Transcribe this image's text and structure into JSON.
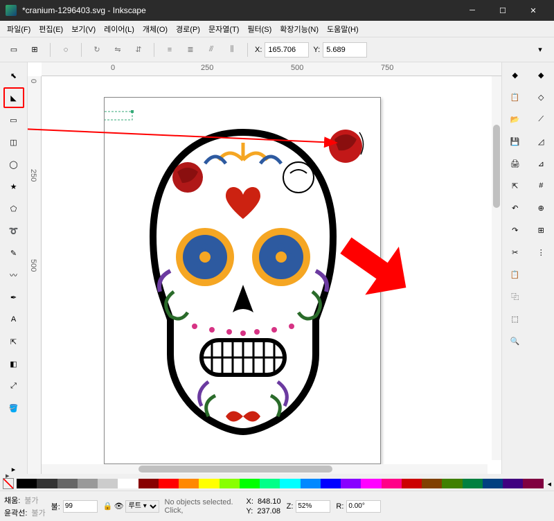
{
  "title": "*cranium-1296403.svg - Inkscape",
  "menus": [
    "파일(F)",
    "편집(E)",
    "보기(V)",
    "레이어(L)",
    "개체(O)",
    "경로(P)",
    "문자열(T)",
    "필터(S)",
    "확장기능(N)",
    "도움말(H)"
  ],
  "coords": {
    "xlabel": "X:",
    "xval": "165.706",
    "ylabel": "Y:",
    "yval": "5.689"
  },
  "ruler_h": [
    "0",
    "250",
    "500",
    "750"
  ],
  "ruler_v": [
    "0",
    "250",
    "500"
  ],
  "tools": [
    {
      "name": "select-tool",
      "glyph": "⬉"
    },
    {
      "name": "node-tool",
      "glyph": "◣",
      "hl": true
    },
    {
      "name": "rect-tool",
      "glyph": "▭"
    },
    {
      "name": "3dbox-tool",
      "glyph": "◫"
    },
    {
      "name": "ellipse-tool",
      "glyph": "◯"
    },
    {
      "name": "star-tool",
      "glyph": "★"
    },
    {
      "name": "poly-tool",
      "glyph": "⬠"
    },
    {
      "name": "spiral-tool",
      "glyph": "➰"
    },
    {
      "name": "pencil-tool",
      "glyph": "✎"
    },
    {
      "name": "bezier-tool",
      "glyph": "〰"
    },
    {
      "name": "calligraphy-tool",
      "glyph": "✒"
    },
    {
      "name": "text-tool",
      "glyph": "A"
    },
    {
      "name": "connector-tool",
      "glyph": "⇱"
    },
    {
      "name": "gradient-tool",
      "glyph": "◧"
    },
    {
      "name": "dropper-tool",
      "glyph": "⤢"
    },
    {
      "name": "paintbucket-tool",
      "glyph": "🪣"
    }
  ],
  "right_col1": [
    {
      "n": "fill-stroke-icon",
      "g": "◆"
    },
    {
      "n": "paste-icon",
      "g": "📋"
    },
    {
      "n": "open-icon",
      "g": "📂"
    },
    {
      "n": "save-icon",
      "g": "💾"
    },
    {
      "n": "print-icon",
      "g": "🖨"
    },
    {
      "n": "export-icon",
      "g": "⇱"
    },
    {
      "n": "undo-icon",
      "g": "↶"
    },
    {
      "n": "redo-icon",
      "g": "↷"
    },
    {
      "n": "cut-icon",
      "g": "✂"
    },
    {
      "n": "clipboard-icon",
      "g": "📋"
    },
    {
      "n": "duplicate-icon",
      "g": "⿻"
    },
    {
      "n": "group-icon",
      "g": "⬚"
    },
    {
      "n": "zoom-icon",
      "g": "🔍"
    }
  ],
  "right_col2": [
    {
      "n": "snap-icon",
      "g": "◆"
    },
    {
      "n": "snap-node-icon",
      "g": "◇"
    },
    {
      "n": "snap-path-icon",
      "g": "⟋"
    },
    {
      "n": "snap-corner-icon",
      "g": "◿"
    },
    {
      "n": "snap-edge-icon",
      "g": "⊿"
    },
    {
      "n": "snap-hash-icon",
      "g": "#"
    },
    {
      "n": "snap-center-icon",
      "g": "⊕"
    },
    {
      "n": "snap-grid-icon",
      "g": "⊞"
    },
    {
      "n": "snap-dots-icon",
      "g": "⋮"
    }
  ],
  "palette": [
    "#000",
    "#333",
    "#666",
    "#999",
    "#ccc",
    "#fff",
    "#800",
    "#f00",
    "#f80",
    "#ff0",
    "#8f0",
    "#0f0",
    "#0f8",
    "#0ff",
    "#08f",
    "#00f",
    "#80f",
    "#f0f",
    "#f08",
    "#c00",
    "#804000",
    "#408000",
    "#008040",
    "#004080",
    "#400080",
    "#800040"
  ],
  "status": {
    "fill_label": "채움:",
    "fill_val": "불가",
    "stroke_label": "윤곽선:",
    "stroke_val": "불가",
    "opacity_label": "불:",
    "opacity_val": "99",
    "layer": "루트 ▾",
    "hint": "No objects selected. Click,",
    "sx": "X:",
    "sxv": "848.10",
    "sy": "Y:",
    "syv": "237.08",
    "zl": "Z:",
    "zv": "52%",
    "rl": "R:",
    "rv": "0.00°"
  }
}
